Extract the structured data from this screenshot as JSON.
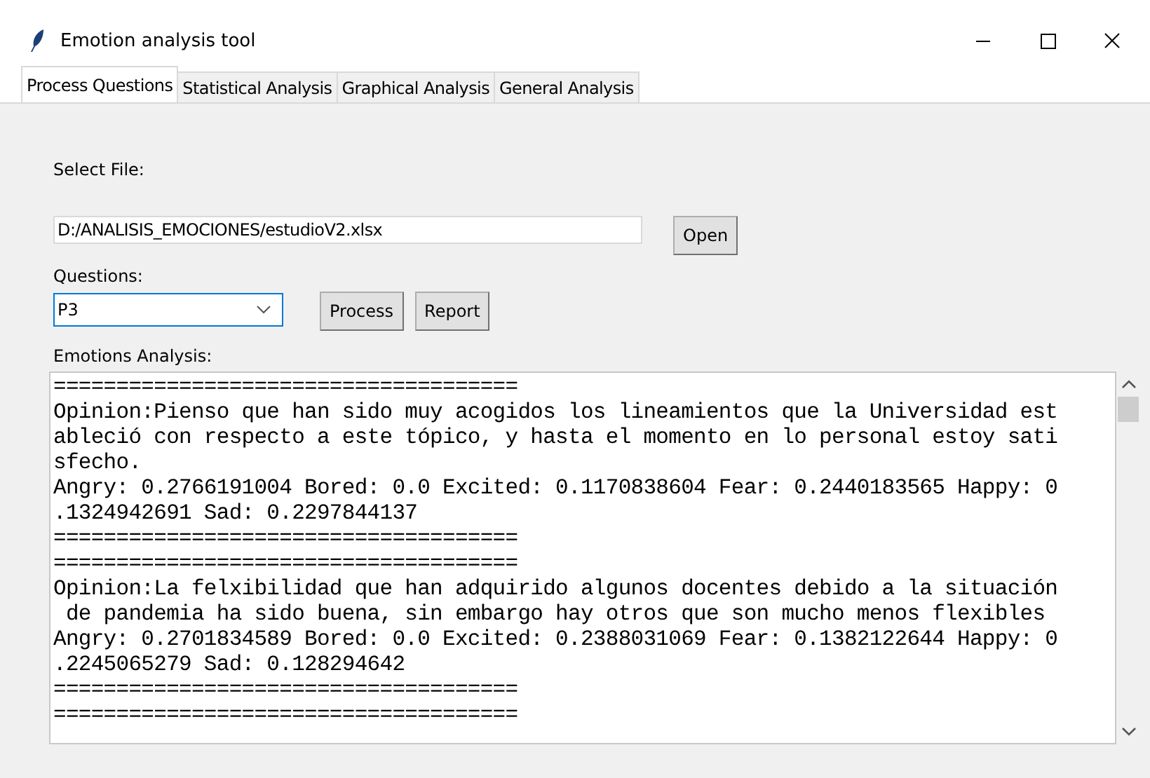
{
  "window": {
    "title": "Emotion analysis tool"
  },
  "tabs": [
    {
      "label": "Process Questions",
      "selected": true
    },
    {
      "label": "Statistical Analysis",
      "selected": false
    },
    {
      "label": "Graphical Analysis",
      "selected": false
    },
    {
      "label": "General Analysis",
      "selected": false
    }
  ],
  "file": {
    "label": "Select File:",
    "value": "D:/ANALISIS_EMOCIONES/estudioV2.xlsx",
    "button": "Open"
  },
  "questions": {
    "label": "Questions:",
    "value": "P3",
    "focused": true,
    "buttons": [
      "Process",
      "Report"
    ]
  },
  "output": {
    "label": "Emotions Analysis:",
    "lines": [
      "=====================================",
      "Opinion:Pienso que han sido muy acogidos los lineamientos que la Universidad est",
      "ableció con respecto a este tópico, y hasta el momento en lo personal estoy sati",
      "sfecho.",
      "Angry: 0.2766191004 Bored: 0.0 Excited: 0.1170838604 Fear: 0.2440183565 Happy: 0",
      ".1324942691 Sad: 0.2297844137",
      "=====================================",
      "=====================================",
      "Opinion:La felxibilidad que han adquirido algunos docentes debido a la situación",
      " de pandemia ha sido buena, sin embargo hay otros que son mucho menos flexibles",
      "Angry: 0.2701834589 Bored: 0.0 Excited: 0.2388031069 Fear: 0.1382122644 Happy: 0",
      ".2245065279 Sad: 0.128294642",
      "=====================================",
      "====================================="
    ]
  }
}
